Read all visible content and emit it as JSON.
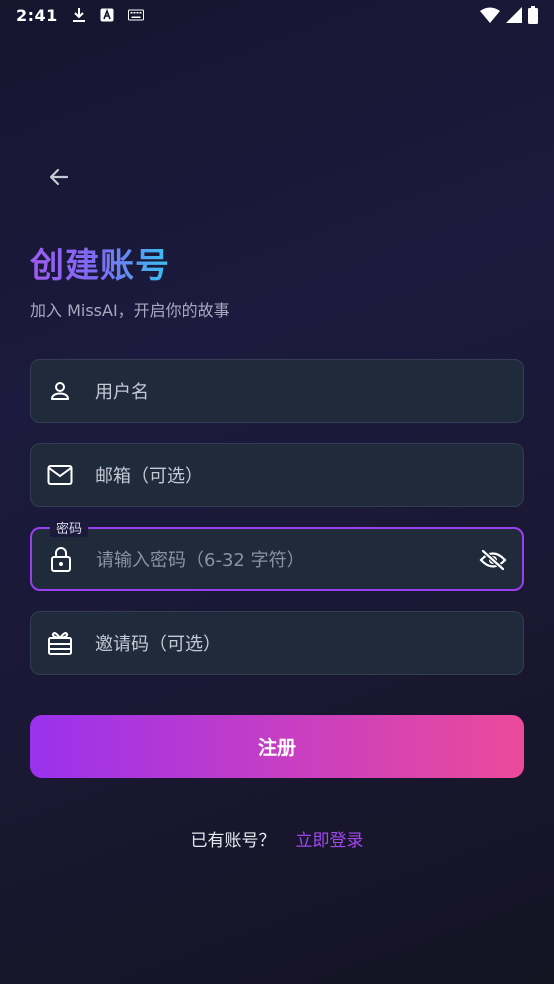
{
  "status": {
    "time": "2:41",
    "left_icons": [
      "download-icon",
      "a-icon",
      "keyboard-icon"
    ],
    "right_icons": [
      "wifi-icon",
      "signal-icon",
      "battery-icon"
    ]
  },
  "header": {
    "back_icon": "arrow-left-icon",
    "title": "创建账号",
    "subtitle": "加入 MissAI，开启你的故事"
  },
  "form": {
    "username": {
      "placeholder": "用户名",
      "icon": "person-icon"
    },
    "email": {
      "placeholder": "邮箱（可选）",
      "icon": "mail-icon"
    },
    "password": {
      "label": "密码",
      "placeholder": "请输入密码（6-32 字符）",
      "icon": "lock-icon",
      "toggle_icon": "eye-off-icon"
    },
    "invite": {
      "placeholder": "邀请码（可选）",
      "icon": "gift-icon"
    },
    "submit_label": "注册"
  },
  "footer": {
    "question": "已有账号？",
    "login_link": "立即登录"
  },
  "colors": {
    "accent": "#9a3ff0",
    "link": "#a048ee",
    "field_bg": "#1f2a3b"
  }
}
